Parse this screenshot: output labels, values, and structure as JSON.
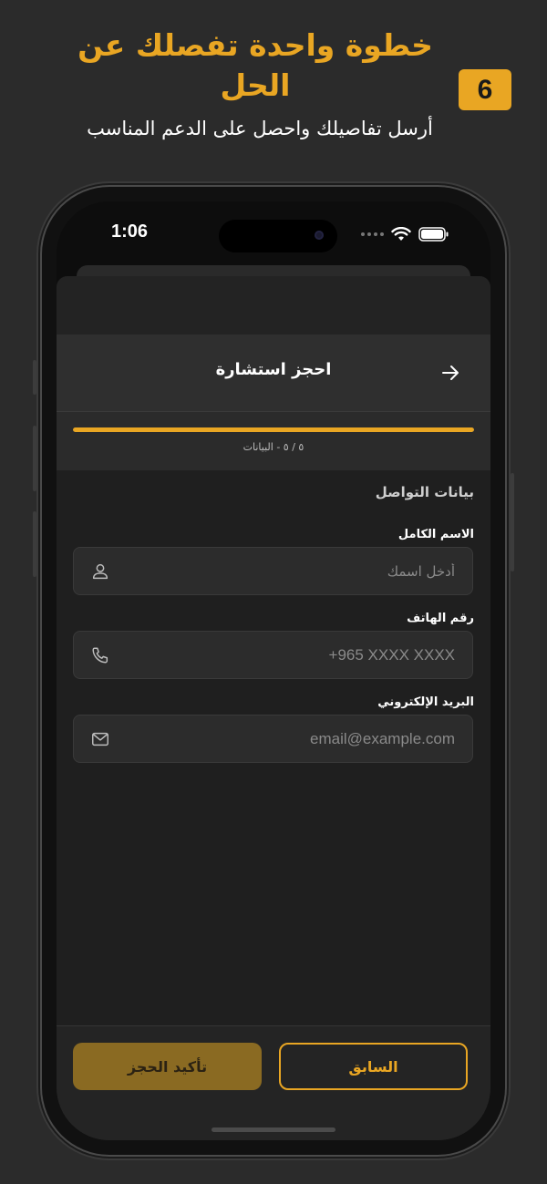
{
  "promo": {
    "title": "خطوة واحدة تفصلك عن الحل",
    "subtitle": "أرسل تفاصيلك واحصل على الدعم المناسب",
    "step_number": "6"
  },
  "status_bar": {
    "time": "1:06"
  },
  "header": {
    "title": "احجز استشارة"
  },
  "progress": {
    "label": "٥ / ٥ - البيانات",
    "fraction": 1.0
  },
  "form": {
    "section_title": "بيانات التواصل",
    "fields": [
      {
        "label": "الاسم الكامل",
        "placeholder": "أدخل اسمك",
        "icon": "user-icon"
      },
      {
        "label": "رقم الهاتف",
        "placeholder": "+965 XXXX XXXX",
        "icon": "phone-icon"
      },
      {
        "label": "البريد الإلكتروني",
        "placeholder": "email@example.com",
        "icon": "mail-icon"
      }
    ]
  },
  "footer": {
    "prev_label": "السابق",
    "confirm_label": "تأكيد الحجز"
  },
  "colors": {
    "accent": "#e9a623",
    "background": "#2b2b2b"
  }
}
